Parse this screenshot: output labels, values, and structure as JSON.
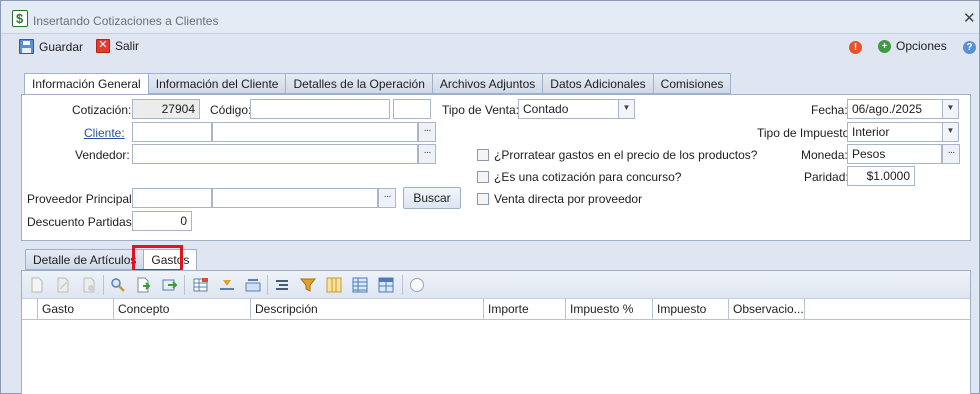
{
  "window": {
    "title": "Insertando Cotizaciones a Clientes"
  },
  "toolbar": {
    "save_label": "Guardar",
    "exit_label": "Salir",
    "options_label": "Opciones"
  },
  "tabs": [
    "Información General",
    "Información del Cliente",
    "Detalles de la Operación",
    "Archivos Adjuntos",
    "Datos Adicionales",
    "Comisiones"
  ],
  "form": {
    "cotizacion_label": "Cotización:",
    "cotizacion_value": "27904",
    "codigo_label": "Código:",
    "tipo_venta_label": "Tipo de Venta:",
    "tipo_venta_value": "Contado",
    "fecha_label": "Fecha:",
    "fecha_value": "06/ago./2025",
    "cliente_label": "Cliente:",
    "tipo_impuesto_label": "Tipo de Impuesto:",
    "tipo_impuesto_value": "Interior",
    "vendedor_label": "Vendedor:",
    "prorratear_label": "¿Prorratear gastos en el precio de los productos?",
    "moneda_label": "Moneda:",
    "moneda_value": "Pesos",
    "concurso_label": "¿Es una cotización para concurso?",
    "paridad_label": "Paridad:",
    "paridad_value": "$1.0000",
    "proveedor_label": "Proveedor Principal:",
    "buscar_label": "Buscar",
    "venta_directa_label": "Venta directa por proveedor",
    "descuento_label": "Descuento Partidas:",
    "descuento_value": "0"
  },
  "subtabs": [
    "Detalle de Artículos",
    "Gastos"
  ],
  "grid": {
    "columns": [
      "Gasto",
      "Concepto",
      "Descripción",
      "Importe",
      "Impuesto %",
      "Impuesto",
      "Observacio..."
    ]
  },
  "colors": {
    "accent": "#2a4fa1",
    "highlight": "#e0141e",
    "alert": "#e6522c",
    "options": "#3f9b3f",
    "help": "#5a8fd8"
  }
}
